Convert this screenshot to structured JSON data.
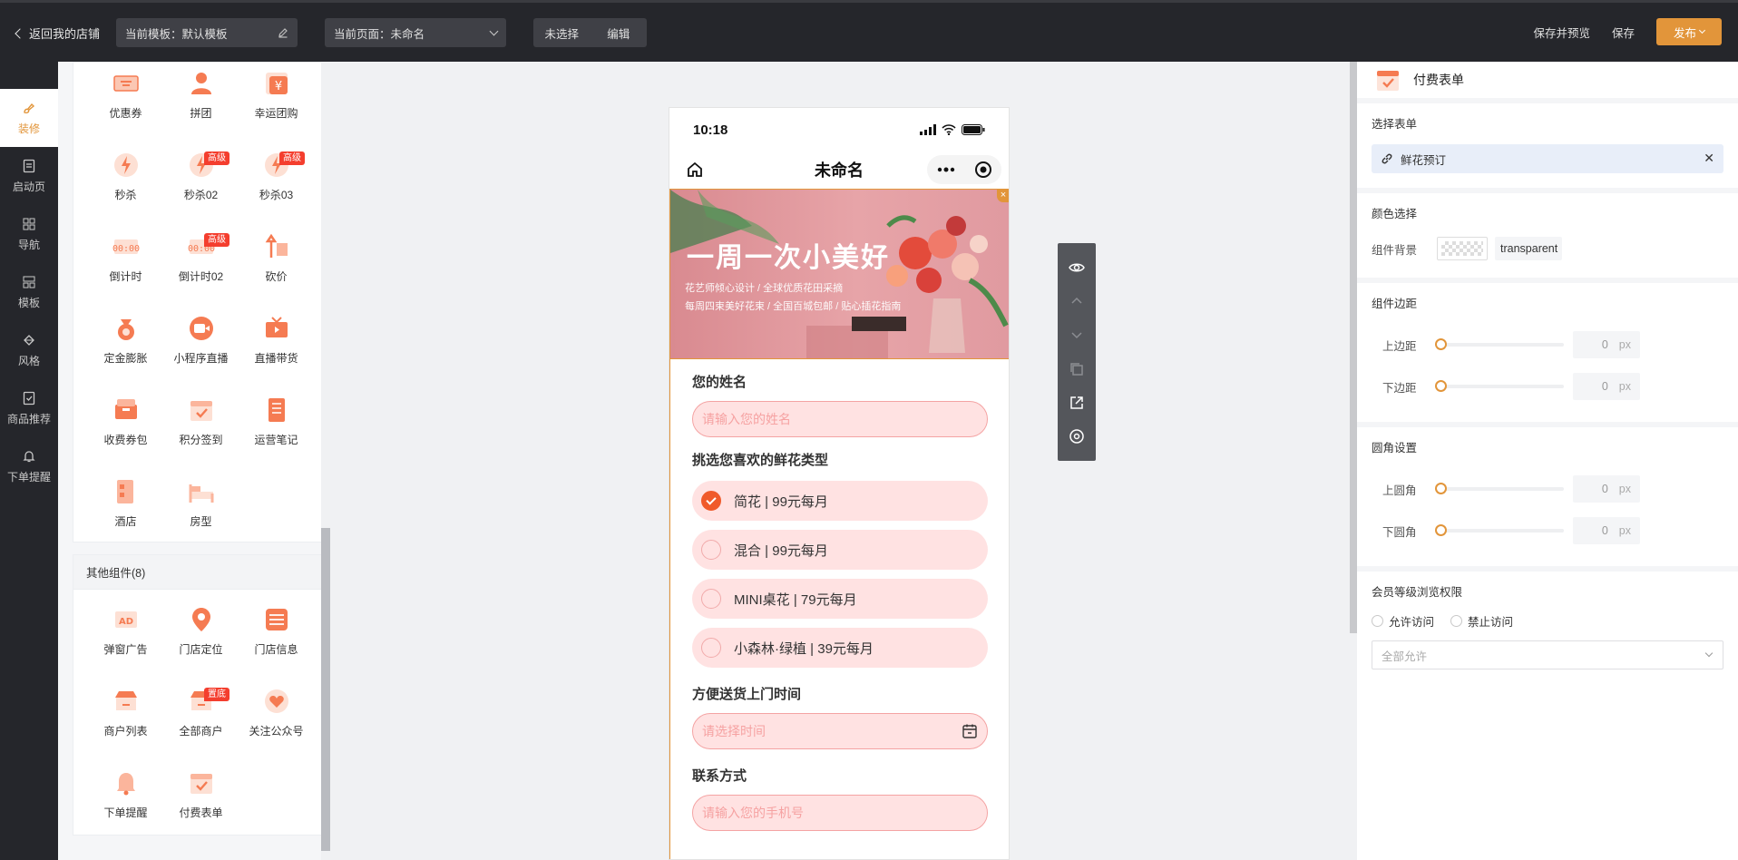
{
  "topbar": {
    "back_label": "返回我的店铺",
    "template_label": "当前模板：默认模板",
    "page_label": "当前页面：未命名",
    "unselected_label": "未选择",
    "edit_label": "编辑",
    "save_preview_label": "保存并预览",
    "save_label": "保存",
    "publish_label": "发布"
  },
  "leftnav": {
    "items": [
      {
        "label": "装修",
        "icon": "brush-icon"
      },
      {
        "label": "启动页",
        "icon": "document-icon"
      },
      {
        "label": "导航",
        "icon": "grid-icon"
      },
      {
        "label": "模板",
        "icon": "template-icon"
      },
      {
        "label": "风格",
        "icon": "paint-bucket-icon"
      },
      {
        "label": "商品推荐",
        "icon": "recommend-icon"
      },
      {
        "label": "下单提醒",
        "icon": "bell-icon"
      }
    ]
  },
  "components": {
    "top_items": [
      {
        "label": "优惠券",
        "badge": ""
      },
      {
        "label": "拼团",
        "badge": ""
      },
      {
        "label": "幸运团购",
        "badge": ""
      },
      {
        "label": "秒杀",
        "badge": ""
      },
      {
        "label": "秒杀02",
        "badge": "高级"
      },
      {
        "label": "秒杀03",
        "badge": "高级"
      },
      {
        "label": "倒计时",
        "badge": ""
      },
      {
        "label": "倒计时02",
        "badge": "高级"
      },
      {
        "label": "砍价",
        "badge": ""
      },
      {
        "label": "定金膨胀",
        "badge": ""
      },
      {
        "label": "小程序直播",
        "badge": ""
      },
      {
        "label": "直播带货",
        "badge": ""
      },
      {
        "label": "收费券包",
        "badge": ""
      },
      {
        "label": "积分签到",
        "badge": ""
      },
      {
        "label": "运营笔记",
        "badge": ""
      },
      {
        "label": "酒店",
        "badge": ""
      },
      {
        "label": "房型",
        "badge": ""
      }
    ],
    "other_group_title": "其他组件(8)",
    "other_items": [
      {
        "label": "弹窗广告",
        "badge": ""
      },
      {
        "label": "门店定位",
        "badge": ""
      },
      {
        "label": "门店信息",
        "badge": ""
      },
      {
        "label": "商户列表",
        "badge": ""
      },
      {
        "label": "全部商户",
        "badge": "置底"
      },
      {
        "label": "关注公众号",
        "badge": ""
      },
      {
        "label": "下单提醒",
        "badge": ""
      },
      {
        "label": "付费表单",
        "badge": ""
      }
    ],
    "ad_text": "AD"
  },
  "phone": {
    "time": "10:18",
    "title": "未命名",
    "banner": {
      "headline": "一周一次小美好",
      "line1": "花艺师倾心设计 / 全球优质花田采摘",
      "line2": "每周四束美好花束 / 全国百城包邮 / 贴心插花指南"
    },
    "form": {
      "name_label": "您的姓名",
      "name_placeholder": "请输入您的姓名",
      "type_label": "挑选您喜欢的鲜花类型",
      "options": [
        {
          "label": "简花 | 99元每月",
          "checked": true
        },
        {
          "label": "混合 | 99元每月",
          "checked": false
        },
        {
          "label": "MINI桌花 | 79元每月",
          "checked": false
        },
        {
          "label": "小森林·绿植 | 39元每月",
          "checked": false
        }
      ],
      "time_label": "方便送货上门时间",
      "time_placeholder": "请选择时间",
      "contact_label": "联系方式",
      "contact_placeholder": "请输入您的手机号"
    }
  },
  "right": {
    "title": "付费表单",
    "select_form_title": "选择表单",
    "selected_form": "鲜花预订",
    "color_title": "颜色选择",
    "bg_label": "组件背景",
    "bg_value": "transparent",
    "margin_title": "组件边距",
    "top_margin_label": "上边距",
    "bottom_margin_label": "下边距",
    "radius_title": "圆角设置",
    "top_radius_label": "上圆角",
    "bottom_radius_label": "下圆角",
    "zero": "0",
    "unit": "px",
    "member_title": "会员等级浏览权限",
    "allow_label": "允许访问",
    "deny_label": "禁止访问",
    "select_placeholder": "全部允许"
  },
  "colors": {
    "accent": "#e2953a",
    "topbar": "#25262b",
    "option_bg": "#ffe2e2",
    "check": "#f05a2a"
  }
}
